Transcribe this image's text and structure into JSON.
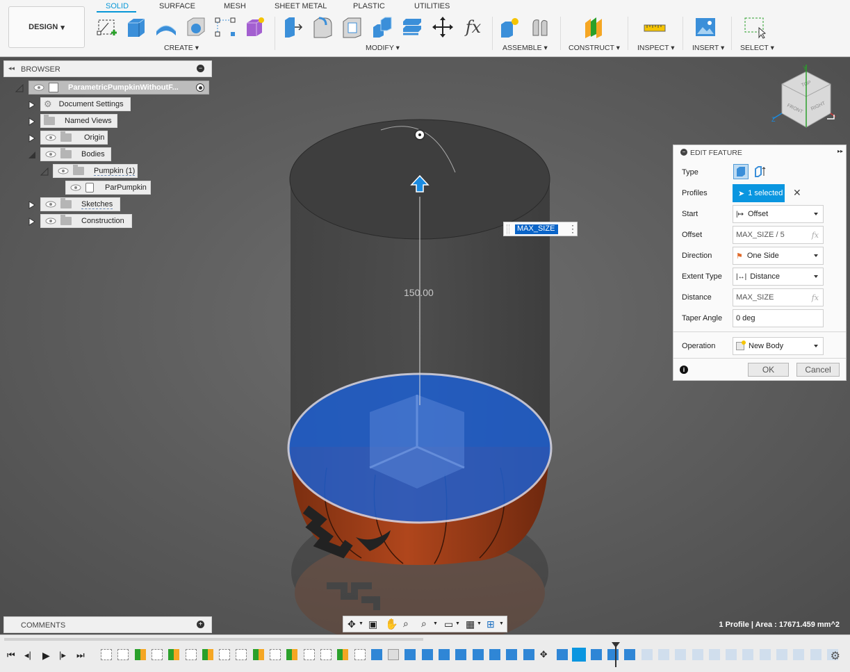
{
  "toolbar": {
    "design_label": "DESIGN",
    "tabs": [
      {
        "label": "SOLID",
        "active": true
      },
      {
        "label": "SURFACE",
        "active": false
      },
      {
        "label": "MESH",
        "active": false
      },
      {
        "label": "SHEET METAL",
        "active": false
      },
      {
        "label": "PLASTIC",
        "active": false
      },
      {
        "label": "UTILITIES",
        "active": false
      }
    ],
    "groups": {
      "create": "CREATE",
      "modify": "MODIFY",
      "assemble": "ASSEMBLE",
      "construct": "CONSTRUCT",
      "inspect": "INSPECT",
      "insert": "INSERT",
      "select": "SELECT"
    }
  },
  "browser": {
    "title": "BROWSER",
    "root": "ParametricPumpkinWithoutF...",
    "items": [
      {
        "label": "Document Settings"
      },
      {
        "label": "Named Views"
      },
      {
        "label": "Origin"
      },
      {
        "label": "Bodies"
      },
      {
        "label": "Pumpkin (1)"
      },
      {
        "label": "ParPumpkin"
      },
      {
        "label": "Sketches"
      },
      {
        "label": "Construction"
      }
    ]
  },
  "comments": {
    "title": "COMMENTS"
  },
  "viewcube": {
    "top": "TOP",
    "front": "FRONT",
    "right": "RIGHT",
    "axis_y": "Y",
    "axis_z": "Z"
  },
  "edit_feature": {
    "title": "EDIT FEATURE",
    "rows": {
      "type": {
        "label": "Type"
      },
      "profiles": {
        "label": "Profiles",
        "value": "1 selected"
      },
      "start": {
        "label": "Start",
        "value": "Offset"
      },
      "offset": {
        "label": "Offset",
        "value": "MAX_SIZE / 5"
      },
      "direction": {
        "label": "Direction",
        "value": "One Side"
      },
      "extent_type": {
        "label": "Extent Type",
        "value": "Distance"
      },
      "distance": {
        "label": "Distance",
        "value": "MAX_SIZE"
      },
      "taper_angle": {
        "label": "Taper Angle",
        "value": "0 deg"
      },
      "operation": {
        "label": "Operation",
        "value": "New Body"
      }
    },
    "ok": "OK",
    "cancel": "Cancel",
    "fx_symbol": "fx"
  },
  "canvas": {
    "dimension": "150.00",
    "inline_input_value": "MAX_SIZE"
  },
  "status": {
    "text": "1 Profile | Area : 17671.459 mm^2"
  },
  "colors": {
    "accent": "#0696d7",
    "viewport": "#5c5c5c",
    "selection": "#1e5fd0",
    "pumpkin": "#b0461c"
  }
}
